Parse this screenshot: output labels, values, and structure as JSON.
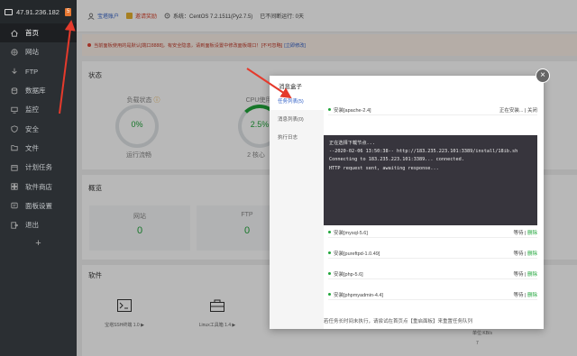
{
  "sidebar": {
    "ip": "47.91.236.182",
    "badge": "5",
    "items": [
      {
        "label": "首页",
        "icon": "home-icon"
      },
      {
        "label": "网站",
        "icon": "globe-icon"
      },
      {
        "label": "FTP",
        "icon": "ftp-icon"
      },
      {
        "label": "数据库",
        "icon": "database-icon"
      },
      {
        "label": "监控",
        "icon": "monitor-icon"
      },
      {
        "label": "安全",
        "icon": "shield-icon"
      },
      {
        "label": "文件",
        "icon": "folder-icon"
      },
      {
        "label": "计划任务",
        "icon": "calendar-icon"
      },
      {
        "label": "软件商店",
        "icon": "store-icon"
      },
      {
        "label": "面板设置",
        "icon": "settings-icon"
      },
      {
        "label": "退出",
        "icon": "exit-icon"
      }
    ],
    "add": "+"
  },
  "header": {
    "account": "宝塔账户",
    "vip": "邀请奖励",
    "system": "系统：CentOS 7.2.1511(Py2.7.5)",
    "uptime": "已不间断运行: 0天"
  },
  "warning": {
    "text": "当前面板使用的是默认[端口8888]，有安全隐患，请到面板设置中修改面板端口！[不可忽略]",
    "link": "[立即修改]"
  },
  "status": {
    "title": "状态",
    "gauges": [
      {
        "label": "负载状态",
        "value": "0%",
        "sub": "运行流畅"
      },
      {
        "label": "CPU使用",
        "value": "2.5%",
        "sub": "2 核心"
      }
    ]
  },
  "overview": {
    "title": "概览",
    "cards": [
      {
        "label": "网站",
        "value": "0"
      },
      {
        "label": "FTP",
        "value": "0"
      }
    ]
  },
  "software": {
    "title": "软件",
    "cards": [
      {
        "label": "宝塔SSH终端 1.0 ▶"
      },
      {
        "label": "Linux工具箱 1.4 ▶"
      }
    ]
  },
  "chart_hint": {
    "unit": "单位:KB/s",
    "tick": "7"
  },
  "modal": {
    "title": "消息盒子",
    "close": "×",
    "tabs": [
      {
        "label": "任务列表(5)"
      },
      {
        "label": "消息列表(0)"
      },
      {
        "label": "执行日志"
      }
    ],
    "tasks": [
      {
        "name": "安装[apache-2.4]",
        "status": "正在安装...",
        "sep": "|",
        "action": "关闭"
      },
      {
        "name": "安装[mysql-5.6]",
        "status": "等待",
        "sep": "|",
        "action": "删除"
      },
      {
        "name": "安装[pureftpd-1.0.49]",
        "status": "等待",
        "sep": "|",
        "action": "删除"
      },
      {
        "name": "安装[php-5.6]",
        "status": "等待",
        "sep": "|",
        "action": "删除"
      },
      {
        "name": "安装[phpmyadmin-4.4]",
        "status": "等待",
        "sep": "|",
        "action": "删除"
      }
    ],
    "console_lines": [
      "正在选择下载节点...",
      "--2020-02-06 13:50:38-- http://183.235.223.101:3389/install/18ib.sh",
      "Connecting to 183.235.223.101:3389... connected.",
      "HTTP request sent, awaiting response..."
    ],
    "footer": "若任务长时间未执行，请尝试在首页点【重启面板】来重置任务队列"
  }
}
